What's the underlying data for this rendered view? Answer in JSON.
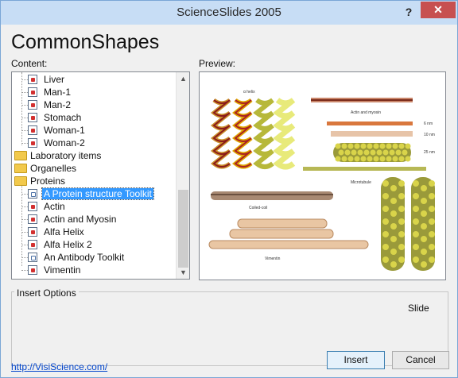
{
  "window": {
    "title": "ScienceSlides 2005",
    "help_glyph": "?",
    "close_glyph": "✕"
  },
  "heading": "CommonShapes",
  "content_label": "Content:",
  "preview_label": "Preview:",
  "tree": {
    "items": [
      {
        "label": "Liver",
        "type": "file"
      },
      {
        "label": "Man-1",
        "type": "file"
      },
      {
        "label": "Man-2",
        "type": "file"
      },
      {
        "label": "Stomach",
        "type": "file"
      },
      {
        "label": "Woman-1",
        "type": "file"
      },
      {
        "label": "Woman-2",
        "type": "file"
      },
      {
        "label": "Laboratory items",
        "type": "folder"
      },
      {
        "label": "Organelles",
        "type": "folder"
      },
      {
        "label": "Proteins",
        "type": "folder"
      },
      {
        "label": "A Protein structure Toolkit",
        "type": "blank",
        "selected": true
      },
      {
        "label": "Actin",
        "type": "file"
      },
      {
        "label": "Actin and Myosin",
        "type": "file"
      },
      {
        "label": "Alfa Helix",
        "type": "file"
      },
      {
        "label": "Alfa Helix 2",
        "type": "file"
      },
      {
        "label": "An Antibody Toolkit",
        "type": "blank"
      },
      {
        "label": "Vimentin",
        "type": "file"
      }
    ]
  },
  "preview": {
    "labels": {
      "helix": "α helix",
      "actin_myosin": "Actin and myosin",
      "nm6": "6 nm",
      "nm10": "10 nm",
      "nm25": "25 nm",
      "microtubule": "Microtubule",
      "coiled_coil": "Coiled-coil",
      "vimentin": "Vimentin"
    }
  },
  "insert_options": {
    "label": "Insert Options",
    "value": "Slide"
  },
  "link": "http://VisiScience.com/",
  "buttons": {
    "insert": "Insert",
    "cancel": "Cancel"
  }
}
